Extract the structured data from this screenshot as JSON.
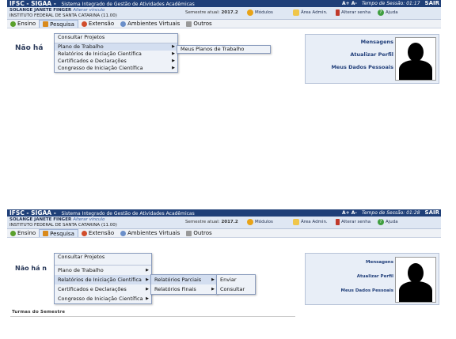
{
  "header": {
    "brand": "IFSC - SIGAA -",
    "subtitle": "Sistema Integrado de Gestão de Atividades Acadêmicas",
    "font_size": "A+ A-",
    "session_label": "Tempo de Sessão:",
    "logout": "SAIR"
  },
  "user": {
    "name": "SOLANGE JANETE FINGER",
    "change_link": "Alterar vínculo",
    "institution": "INSTITUTO FEDERAL DE SANTA CATARINA (11.00)"
  },
  "semester": {
    "label": "Semestre atual:",
    "value": "2017.2"
  },
  "shortcuts": {
    "modules": "Módulos",
    "admin": "Área Admin.",
    "password": "Alterar senha",
    "help": "Ajuda"
  },
  "menu": [
    "Ensino",
    "Pesquisa",
    "Extensão",
    "Ambientes Virtuais",
    "Outros"
  ],
  "pesquisa_menu": [
    {
      "label": "Consultar Projetos"
    },
    {
      "label": "Plano de Trabalho"
    },
    {
      "label": "Relatórios de Iniciação Científica"
    },
    {
      "label": "Certificados e Declarações"
    },
    {
      "label": "Congresso de Iniciação Científica"
    }
  ],
  "shot1": {
    "session_time": "01:17",
    "submenu_plano": [
      "Meus Planos de Trabalho"
    ],
    "main_heading": "Não há"
  },
  "shot2": {
    "session_time": "01:28",
    "submenu_relatorios": [
      "Relatórios Parciais",
      "Relatórios Finais"
    ],
    "submenu_parciais": [
      "Enviar",
      "Consultar"
    ],
    "main_heading": "Não há n",
    "turmas_label": "Turmas do Semestre"
  },
  "sidebar": {
    "messages": "Mensagens",
    "update_profile": "Atualizar Perfil",
    "personal_data": "Meus Dados Pessoais"
  },
  "colors": {
    "header_bg": "#1f3f78",
    "link": "#213f7a"
  }
}
